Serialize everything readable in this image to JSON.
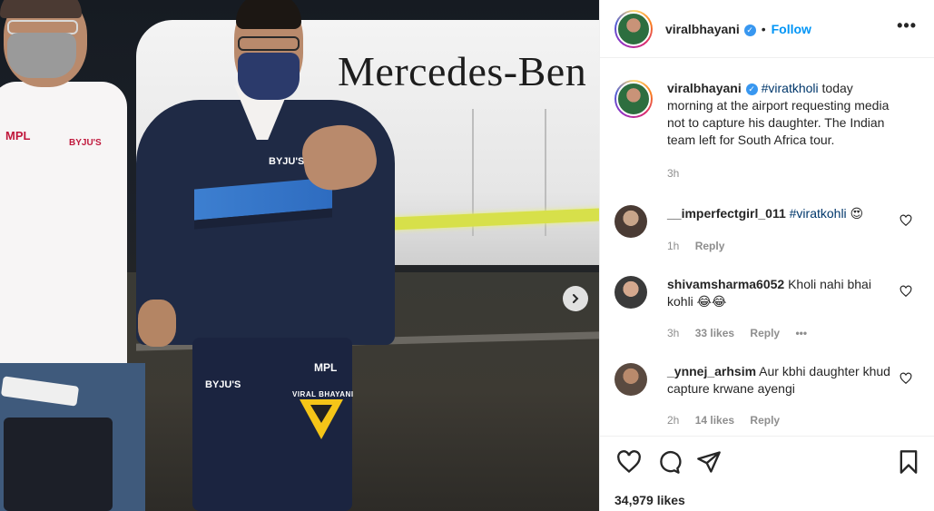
{
  "photo": {
    "bus_text": "Mercedes-Ben",
    "badge_left_1": "MPL",
    "badge_left_2": "BYJU'S",
    "jacket_logo": "BYJU'S",
    "pants_logo_1": "MPL",
    "pants_logo_2": "BYJU'S",
    "watermark": "VIRAL BHAYANI",
    "next_icon": "chevron-right-icon"
  },
  "header": {
    "username": "viralbhayani",
    "dot": "•",
    "follow_label": "Follow",
    "more_label": "•••"
  },
  "caption": {
    "username": "viralbhayani",
    "hashtag": "#viratkholi",
    "text": " today morning at the airport requesting media not to capture his daughter. The Indian team left for South Africa tour.",
    "time": "3h"
  },
  "comments": [
    {
      "username": "__imperfectgirl_011",
      "tag": "#viratkohli",
      "text": " 😍",
      "time": "1h",
      "likes": "",
      "reply": "Reply"
    },
    {
      "username": "shivamsharma6052",
      "tag": "",
      "text": " Kholi nahi bhai kohli 😂😂",
      "time": "3h",
      "likes": "33 likes",
      "reply": "Reply",
      "more": "•••"
    },
    {
      "username": "_ynnej_arhsim",
      "tag": "",
      "text": " Aur kbhi daughter khud capture krwane ayengi",
      "time": "2h",
      "likes": "14 likes",
      "reply": "Reply"
    }
  ],
  "actions": {
    "likes_count": "34,979 likes",
    "icons": [
      "heart-icon",
      "comment-icon",
      "share-icon",
      "bookmark-icon"
    ]
  },
  "colors": {
    "link": "#0095f6",
    "hashtag": "#00376b",
    "muted": "#8e8e8e",
    "verified": "#3897f0"
  }
}
